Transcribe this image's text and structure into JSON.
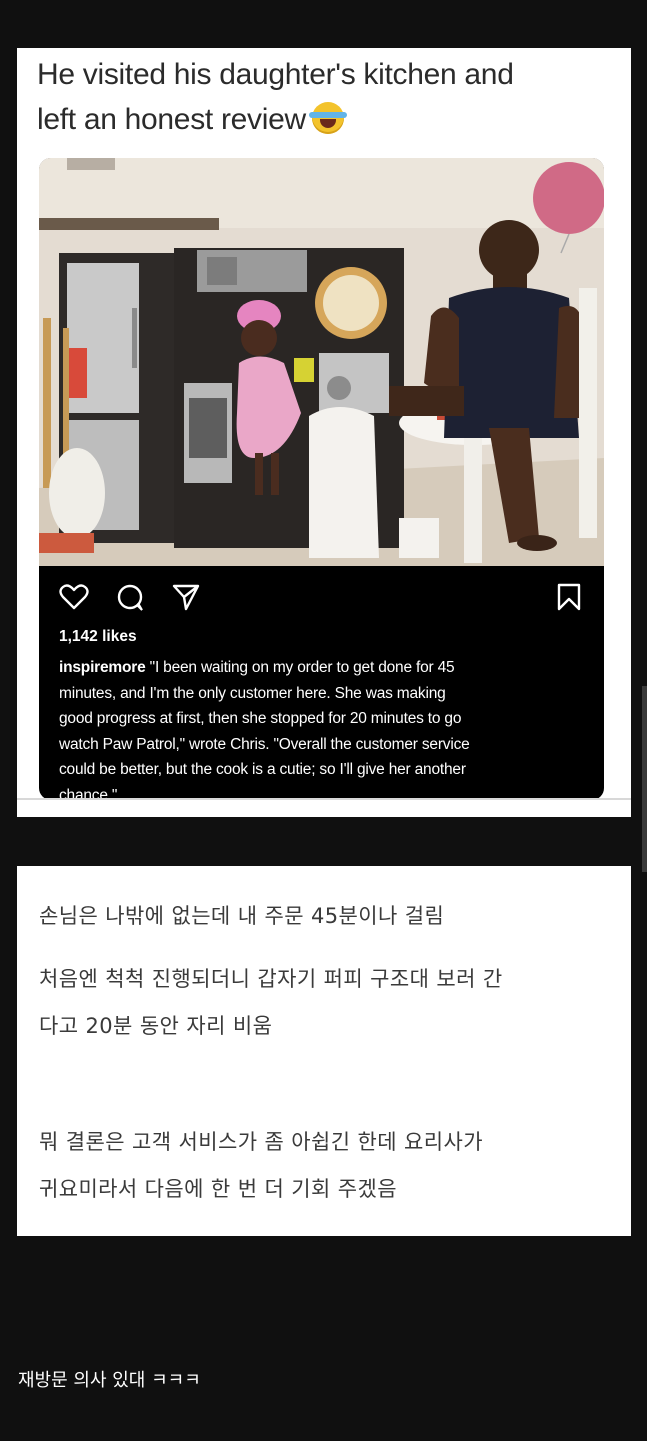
{
  "card": {
    "headline_line1": "He visited his daughter's kitchen and",
    "headline_line2": "left an honest review"
  },
  "post": {
    "likes": "1,142 likes",
    "username": "inspiremore",
    "caption_lines": [
      " \"I been waiting on my order to get done for 45",
      "minutes, and I'm the only customer here. She was making",
      "good progress at first, then she stopped for 20 minutes to go",
      "watch Paw Patrol,\" wrote Chris. \"Overall the customer service",
      "could be better, but the cook is a cutie; so I'll give her another",
      "chance.\""
    ],
    "icons": [
      "heart-icon",
      "comment-icon",
      "share-icon",
      "bookmark-icon"
    ]
  },
  "translation": {
    "lines": [
      "손님은 나밖에 없는데 내 주문 45분이나 걸림",
      "처음엔 척척 진행되더니 갑자기 퍼피 구조대 보러 간",
      "다고 20분 동안 자리 비움",
      "뭐 결론은 고객 서비스가 좀 아쉽긴 한데 요리사가",
      "귀요미라서 다음에 한 번 더 기회 주겠음"
    ]
  },
  "footer": {
    "text": "재방문 의사 있대 ㅋㅋㅋ"
  },
  "colors": {
    "page_bg": "#101010",
    "card_bg": "#ffffff",
    "post_bg": "#000000",
    "post_text": "#ffffff",
    "translation_text": "#3a3a3a"
  }
}
